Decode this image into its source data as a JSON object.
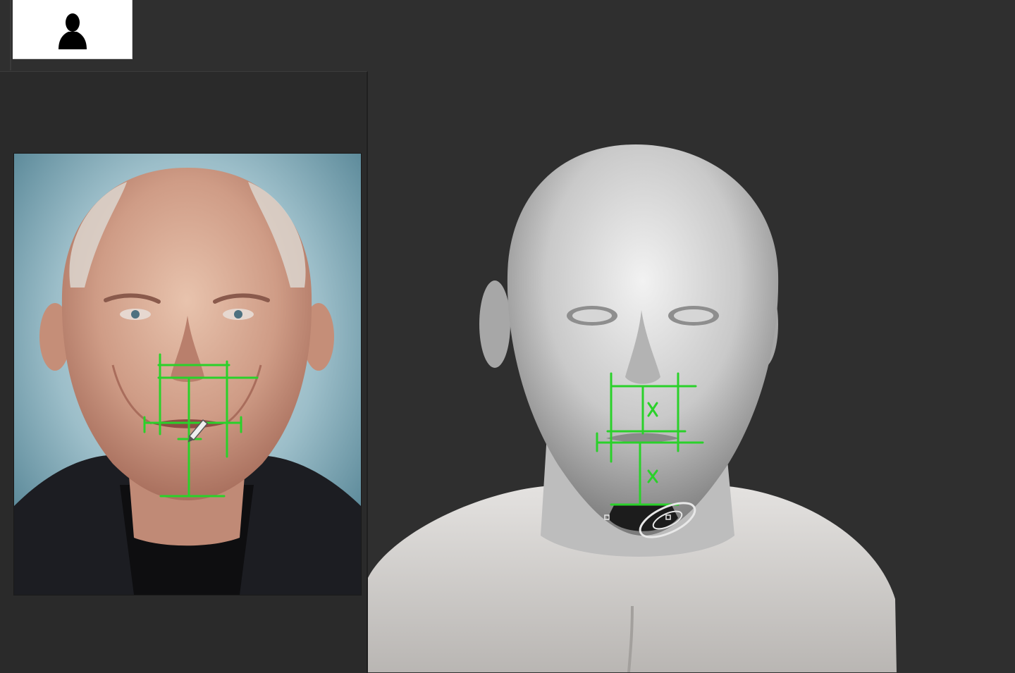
{
  "avatar_tile": {
    "icon": "user-silhouette-icon"
  },
  "reference_panel": {
    "image": "reference-portrait-photo"
  },
  "viewport": {
    "model": "sculpted-head-bust"
  },
  "overlay": {
    "color": "#2ad12a",
    "cursor": "pen-cursor-icon",
    "gizmo": "transform-gizmo-icon"
  },
  "colors": {
    "background": "#2f2f2f",
    "panel": "#2a2a2a",
    "tile": "#ffffff"
  }
}
